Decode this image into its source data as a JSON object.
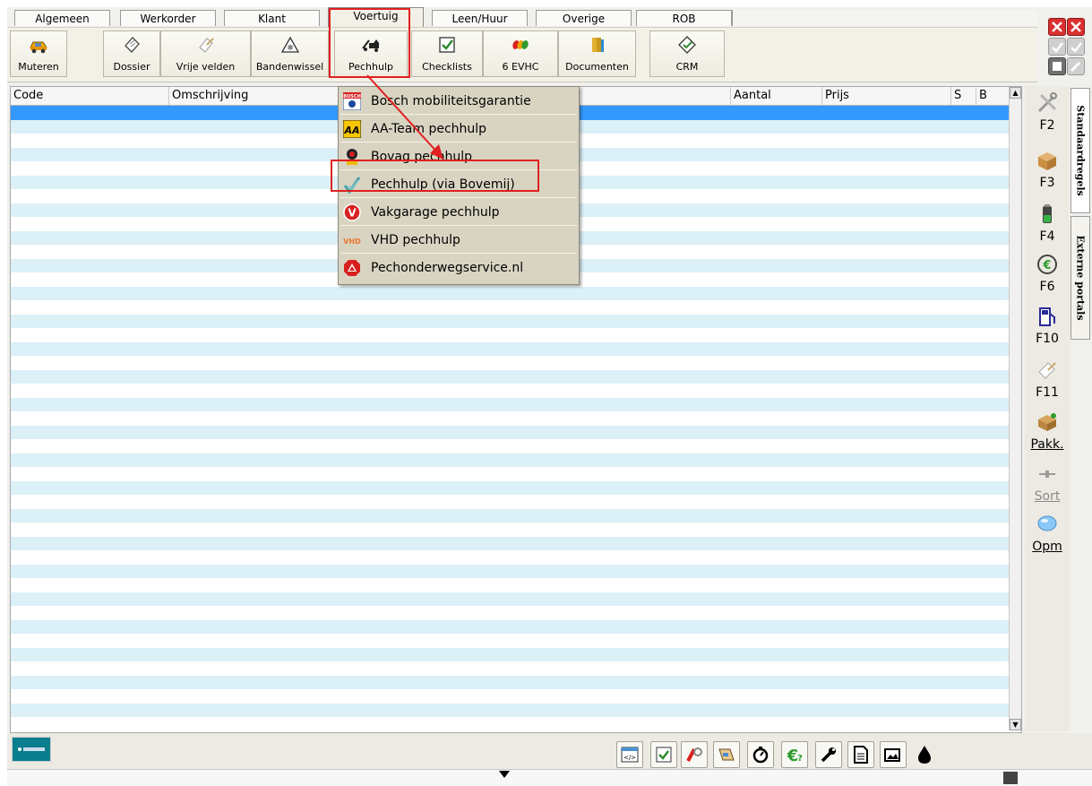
{
  "tabs": [
    "Algemeen",
    "Werkorder",
    "Klant",
    "Voertuig",
    "Leen/Huur",
    "Overige",
    "ROB"
  ],
  "active_tab": "Voertuig",
  "ribbon": {
    "mutate": "Muteren",
    "dossier": "Dossier",
    "free_fields": "Vrije velden",
    "tyre_change": "Bandenwissel",
    "breakdown": "Pechhulp",
    "checklists": "Checklists",
    "evhc": "6 EVHC",
    "documents": "Documenten",
    "crm": "CRM"
  },
  "grid": {
    "columns": [
      "Code",
      "Omschrijving",
      "Aantal",
      "Prijs",
      "S",
      "B"
    ]
  },
  "dropdown": {
    "items": [
      "Bosch mobiliteitsgarantie",
      "AA-Team pechhulp",
      "Bovag pechhulp",
      "Pechhulp (via Bovemij)",
      "Vakgarage pechhulp",
      "VHD pechhulp",
      "Pechonderwegservice.nl"
    ],
    "highlighted": "Pechhulp (via Bovemij)"
  },
  "side_buttons": [
    "F2",
    "F3",
    "F4",
    "F6",
    "F10",
    "F11",
    "Pakk.",
    "Sort",
    "Opm"
  ],
  "vertical_tabs": [
    "Standaardregels",
    "Externe portals"
  ],
  "colors": {
    "highlight_box": "#e02020",
    "selected_row": "#3399ff",
    "stripe": "#dcf0f8"
  }
}
